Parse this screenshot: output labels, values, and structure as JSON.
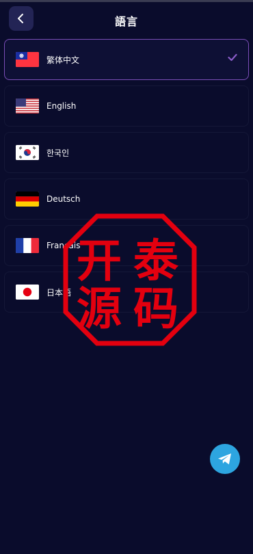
{
  "header": {
    "title": "語言",
    "back_icon": "chevron-left-icon"
  },
  "languages": [
    {
      "label": "繁体中文",
      "flag": "taiwan-flag",
      "selected": true
    },
    {
      "label": "English",
      "flag": "usa-flag",
      "selected": false
    },
    {
      "label": "한국인",
      "flag": "korea-flag",
      "selected": false
    },
    {
      "label": "Deutsch",
      "flag": "germany-flag",
      "selected": false
    },
    {
      "label": "Français",
      "flag": "france-flag",
      "selected": false
    },
    {
      "label": "日本語",
      "flag": "japan-flag",
      "selected": false
    }
  ],
  "watermark": {
    "text": "开泰源码",
    "color": "#e3000f"
  },
  "colors": {
    "background": "#0a0c2c",
    "selected_border": "#7b4eb8",
    "check": "#8a5cc9",
    "telegram": "#2da5e0"
  },
  "fab": {
    "icon": "telegram-icon"
  }
}
